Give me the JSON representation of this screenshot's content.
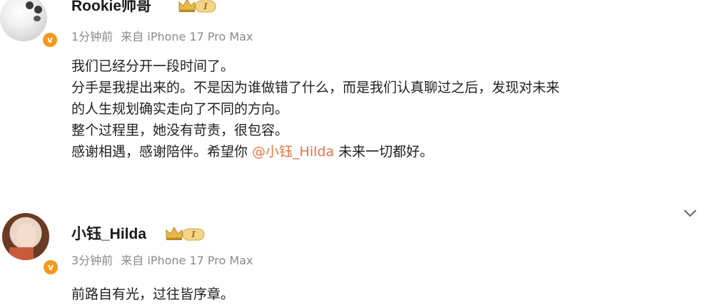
{
  "post1": {
    "username": "Rookie帅哥",
    "level_badge": "I",
    "time": "1分钟前",
    "source": "来自 iPhone 17 Pro Max",
    "lines": [
      "我们已经分开一段时间了。",
      "分手是我提出来的。不是因为谁做错了什么，而是我们认真聊过之后，发现对未来",
      "的人生规划确实走向了不同的方向。",
      "整个过程里，她没有苛责，很包容。"
    ],
    "last_line_prefix": "感谢相遇，感谢陪伴。希望你 ",
    "mention": "@小钰_Hilda",
    "last_line_suffix": " 未来一切都好。"
  },
  "post2": {
    "username": "小钰_Hilda",
    "level_badge": "I",
    "time": "3分钟前",
    "source": "来自 iPhone 17 Pro Max",
    "text": "前路自有光，过往皆序章。"
  },
  "colors": {
    "mention": "#eb7340",
    "verified_badge": "#f39a1e",
    "meta": "#8a8a8a"
  },
  "icons": [
    "avatar",
    "verified-v-icon",
    "crown-level-icon",
    "chevron-down-icon"
  ]
}
